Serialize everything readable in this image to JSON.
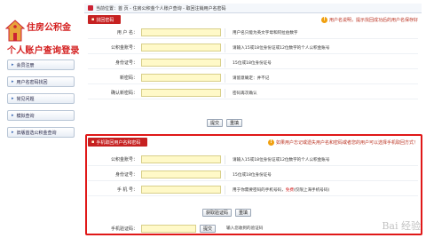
{
  "logo": {
    "line1": "住房公积金",
    "line2": "个人账户查询登录"
  },
  "nav": [
    {
      "label": "会员注册"
    },
    {
      "label": "用户名密码找回"
    },
    {
      "label": "常见问题"
    },
    {
      "label": "模拟查询"
    },
    {
      "label": "旧版首选公积金查询"
    }
  ],
  "topbar": {
    "text": "当前位置：首 页 - 住房公积金个人账户查询 - 取回注销用户名密码"
  },
  "section1": {
    "tab": "找回密码",
    "note": "用户名说明，提示找回成功后的用户名保存好",
    "rows": [
      {
        "label": "用 户 名：",
        "hint": "用户名只能为英文字母和阿拉伯数字"
      },
      {
        "label": "公积金账号：",
        "hint": "请输入15或18位身份证或12位数字的个人公积金账号"
      },
      {
        "label": "身份证号：",
        "hint": "15位或18位身份证号"
      },
      {
        "label": "新密码：",
        "hint": "请留意确定：并不记"
      },
      {
        "label": "确认新密码：",
        "hint": "密码再次确认"
      }
    ],
    "buttons": [
      "提交",
      "重填"
    ]
  },
  "section2": {
    "tab": "手机取回用户名和密码",
    "note": "如果用户忘记或遗失用户名和密码或者您的用户可以选择手机取回方式！",
    "rows": [
      {
        "label": "公积金账号：",
        "hint": "请输入15或18位身份证或12位数字的个人公积金账号"
      },
      {
        "label": "身份证号：",
        "hint": "15位或18位身份证号"
      },
      {
        "label": "手 机 号：",
        "hint": "用于你需要密码的手机号码，",
        "hint_red": "免费",
        "hint_tail": "(仅限上海手机号码)"
      }
    ],
    "buttons": [
      "获取验证码",
      "重填"
    ],
    "verify": {
      "label": "手机验证码：",
      "button": "提交",
      "hint": "输入您收到的验证码"
    }
  },
  "watermark": "Bai 经验",
  "colors": {
    "accent": "#c62121",
    "input_bg": "#fff9c8",
    "highlight_border": "#e01818"
  }
}
